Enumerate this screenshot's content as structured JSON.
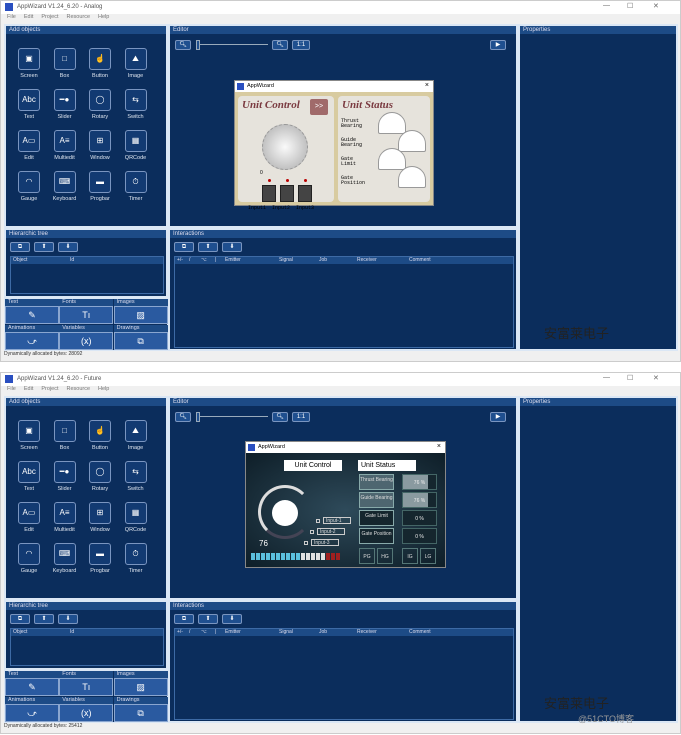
{
  "windows": [
    {
      "title": "AppWizard V1.24_6.20 - Analog",
      "status": "Dynamically allocated bytes: 28092",
      "theme": "analog"
    },
    {
      "title": "AppWizard V1.24_6.20 - Future",
      "status": "Dynamically allocated bytes: 25412",
      "theme": "future"
    }
  ],
  "menu": [
    "File",
    "Edit",
    "Project",
    "Resource",
    "Help"
  ],
  "panels": {
    "add_objects": "Add objects",
    "editor": "Editor",
    "properties": "Properties",
    "hierarchic_tree": "Hierarchic tree",
    "interactions": "Interactions"
  },
  "editor_zoom_reset": "1:1",
  "objects": [
    {
      "label": "Screen",
      "icon": "▣"
    },
    {
      "label": "Box",
      "icon": "□"
    },
    {
      "label": "Button",
      "icon": "☝"
    },
    {
      "label": "Image",
      "icon": "⛰"
    },
    {
      "label": "Text",
      "icon": "Abc"
    },
    {
      "label": "Slider",
      "icon": "━●"
    },
    {
      "label": "Rotary",
      "icon": "◯"
    },
    {
      "label": "Switch",
      "icon": "⇆"
    },
    {
      "label": "Edit",
      "icon": "A▭"
    },
    {
      "label": "Multiedit",
      "icon": "A≡"
    },
    {
      "label": "Window",
      "icon": "⊞"
    },
    {
      "label": "QRCode",
      "icon": "▦"
    },
    {
      "label": "Gauge",
      "icon": "◠"
    },
    {
      "label": "Keyboard",
      "icon": "⌨"
    },
    {
      "label": "Progbar",
      "icon": "▬"
    },
    {
      "label": "Timer",
      "icon": "⏱"
    }
  ],
  "tree_columns": [
    "Object",
    "Id"
  ],
  "interaction_columns": [
    "+/-",
    "/",
    "⌥",
    "|",
    "Emitter",
    "Signal",
    "Job",
    "Receiver",
    "Comment"
  ],
  "resources": [
    {
      "label": "Text",
      "icon": "✎"
    },
    {
      "label": "Fonts",
      "icon": "Tı"
    },
    {
      "label": "Images",
      "icon": "▨"
    },
    {
      "label": "Animations",
      "icon": "⤻"
    },
    {
      "label": "Variables",
      "icon": "(x)"
    },
    {
      "label": "Drawings",
      "icon": "⧉"
    }
  ],
  "dialog": {
    "title": "AppWizard",
    "close": "×"
  },
  "analog": {
    "unit_control": "Unit Control",
    "next": ">>",
    "unit_status": "Unit Status",
    "knob_value": "0",
    "inputs": [
      "Input1",
      "Input2",
      "Input3"
    ],
    "status_labels": [
      "Thrust Bearing",
      "Guide Bearing",
      "Gate Limit",
      "Gate Position"
    ]
  },
  "future": {
    "unit_control": "Unit Control",
    "unit_status": "Unit Status",
    "value": "76",
    "inputs": [
      "Input-1",
      "Input-2",
      "Input-3"
    ],
    "status_labels": [
      "Thrust Bearing",
      "Guide Bearing",
      "Gate Limit",
      "Gate Position"
    ],
    "status_values": [
      "76 %",
      "76 %",
      "0 %",
      "0 %"
    ],
    "buttons": [
      "PG",
      "HG",
      "IG",
      "LG"
    ],
    "bar_colors": {
      "on": "#5bc0de",
      "off": "#e0e0e0",
      "alarm": "#a02020"
    },
    "bar_levels": [
      "on",
      "on",
      "on",
      "on",
      "on",
      "on",
      "on",
      "on",
      "on",
      "on",
      "off",
      "off",
      "off",
      "off",
      "off",
      "alarm",
      "alarm",
      "alarm"
    ]
  },
  "watermark": {
    "text": "安富莱电子",
    "site": "@51CTO博客"
  }
}
